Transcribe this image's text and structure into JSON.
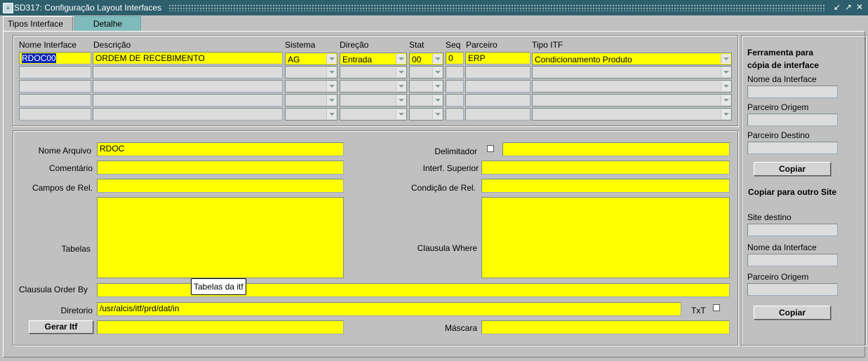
{
  "window": {
    "title": "SD317: Configuração Layout Interfaces",
    "app_icon": "oracle-forms-icon",
    "controls": [
      "minimize-icon",
      "maximize-icon",
      "close-icon"
    ]
  },
  "tabs": [
    {
      "label": "Tipos Interface",
      "active": true
    },
    {
      "label": "Detalhe",
      "active": false
    }
  ],
  "grid": {
    "headers": {
      "nome": "Nome Interface",
      "descricao": "Descrição",
      "sistema": "Sistema",
      "direcao": "Direção",
      "stat": "Stat",
      "seq": "Seq",
      "parceiro": "Parceiro",
      "tipo_itf": "Tipo ITF"
    },
    "rows": [
      {
        "nome": "RDOC00",
        "descricao": "ORDEM DE RECEBIMENTO",
        "sistema": "AG",
        "direcao": "Entrada",
        "stat": "00",
        "seq": "0",
        "parceiro": "ERP",
        "tipo_itf": "Condicionamento Produto"
      },
      {
        "nome": "",
        "descricao": "",
        "sistema": "",
        "direcao": "",
        "stat": "",
        "seq": "",
        "parceiro": "",
        "tipo_itf": ""
      },
      {
        "nome": "",
        "descricao": "",
        "sistema": "",
        "direcao": "",
        "stat": "",
        "seq": "",
        "parceiro": "",
        "tipo_itf": ""
      },
      {
        "nome": "",
        "descricao": "",
        "sistema": "",
        "direcao": "",
        "stat": "",
        "seq": "",
        "parceiro": "",
        "tipo_itf": ""
      },
      {
        "nome": "",
        "descricao": "",
        "sistema": "",
        "direcao": "",
        "stat": "",
        "seq": "",
        "parceiro": "",
        "tipo_itf": ""
      }
    ]
  },
  "detail": {
    "nome_arquivo": {
      "label": "Nome Arquivo",
      "value": "RDOC"
    },
    "comentario": {
      "label": "Comentário",
      "value": ""
    },
    "campos_rel": {
      "label": "Campos de Rel.",
      "value": ""
    },
    "tabelas": {
      "label": "Tabelas",
      "value": ""
    },
    "clausula_order_by": {
      "label": "Clausula Order By",
      "value": ""
    },
    "diretorio": {
      "label": "Diretorio",
      "value": "/usr/alcis/itf/prd/dat/in"
    },
    "gerar_itf": {
      "label": "Gerar Itf",
      "value": ""
    },
    "delimitador": {
      "label": "Delimitador",
      "checked": false,
      "value": ""
    },
    "interf_superior": {
      "label": "Interf. Superior",
      "value": ""
    },
    "condicao_rel": {
      "label": "Condição de Rel.",
      "value": ""
    },
    "clausula_where": {
      "label": "Clausula Where",
      "value": ""
    },
    "txt": {
      "label": "TxT",
      "checked": false
    },
    "mascara": {
      "label": "Máscara",
      "value": ""
    },
    "tooltip": "Tabelas da itf"
  },
  "copy_tool": {
    "title": "Ferramenta para cópia de interface",
    "nome_interface": {
      "label": "Nome da Interface",
      "value": ""
    },
    "parceiro_origem": {
      "label": "Parceiro Origem",
      "value": ""
    },
    "parceiro_destino": {
      "label": "Parceiro Destino",
      "value": ""
    },
    "copiar_label": "Copiar"
  },
  "copy_site": {
    "title": "Copiar para outro Site",
    "site_destino": {
      "label": "Site destino",
      "value": ""
    },
    "nome_interface": {
      "label": "Nome da Interface",
      "value": ""
    },
    "parceiro_origem": {
      "label": "Parceiro Origem",
      "value": ""
    },
    "copiar_label": "Copiar"
  },
  "colors": {
    "titlebar": "#2e5f6c",
    "field_required": "#ffff00",
    "field_empty": "#dcdcdc",
    "background": "#c0c0c0",
    "tab_inactive": "#7fbbbb"
  }
}
